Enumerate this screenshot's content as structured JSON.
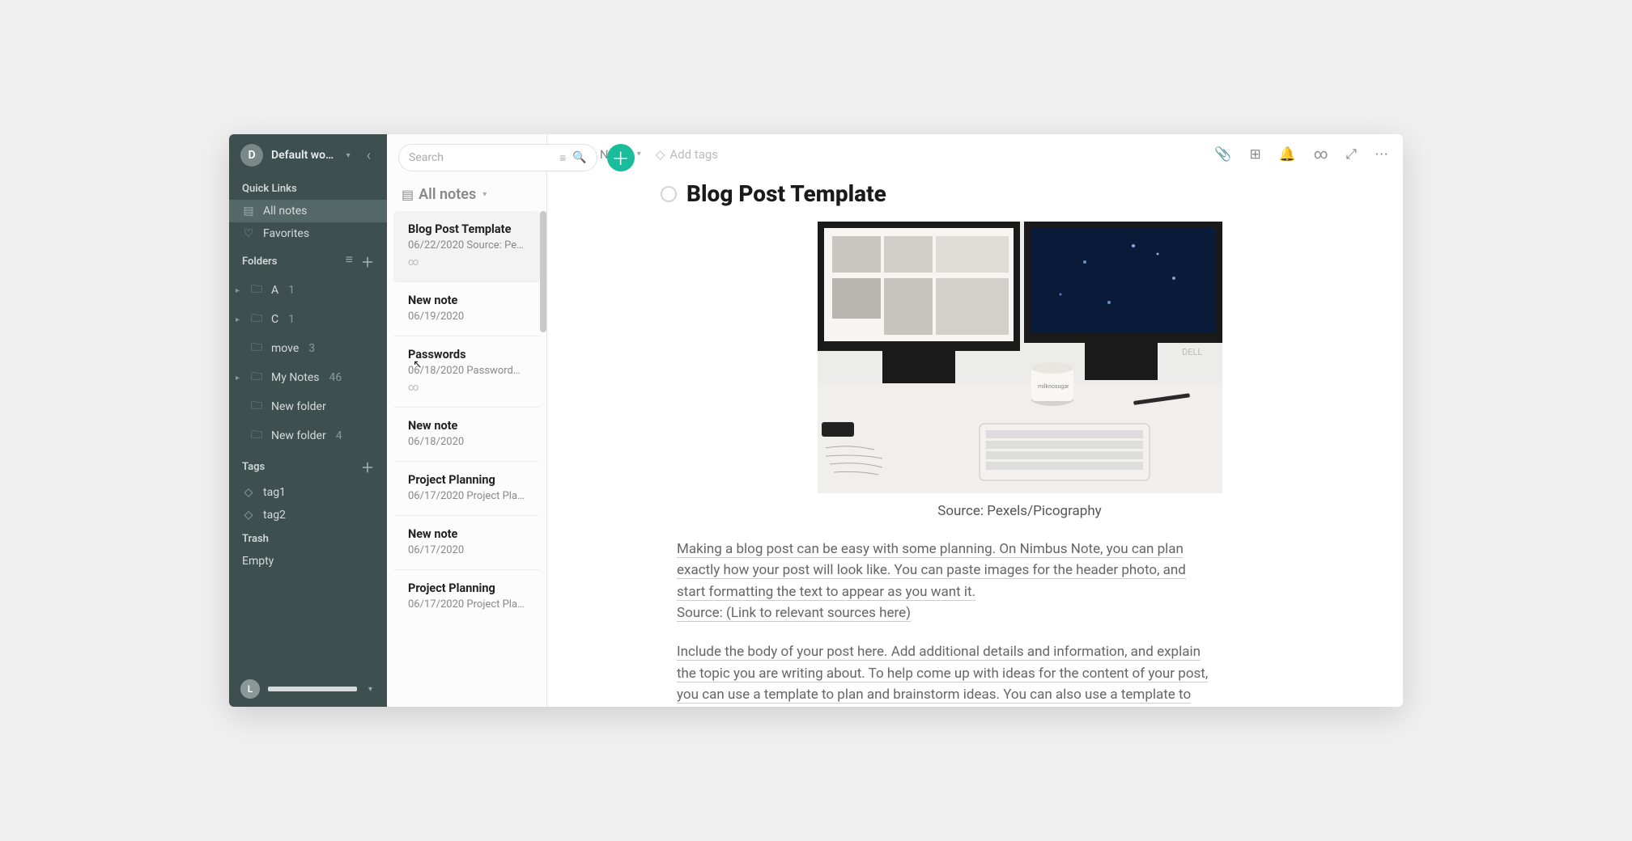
{
  "workspace": {
    "avatar_letter": "D",
    "name": "Default wor…"
  },
  "sidebar": {
    "quicklinks_label": "Quick Links",
    "quicklinks": [
      {
        "icon": "▤",
        "label": "All notes",
        "active": true
      },
      {
        "icon": "♡",
        "label": "Favorites"
      }
    ],
    "folders_label": "Folders",
    "folders": [
      {
        "label": "A",
        "count": "1",
        "expandable": true,
        "icon": "folder-share"
      },
      {
        "label": "C",
        "count": "1",
        "expandable": true,
        "icon": "folder"
      },
      {
        "label": "move",
        "count": "3",
        "expandable": false,
        "icon": "folder"
      },
      {
        "label": "My Notes",
        "count": "46",
        "expandable": true,
        "icon": "folder"
      },
      {
        "label": "New folder",
        "count": "",
        "expandable": false,
        "icon": "folder"
      },
      {
        "label": "New folder",
        "count": "4",
        "expandable": false,
        "icon": "folder-share"
      }
    ],
    "tags_label": "Tags",
    "tags": [
      {
        "label": "tag1"
      },
      {
        "label": "tag2"
      }
    ],
    "trash_label": "Trash",
    "trash_empty": "Empty",
    "user_letter": "L"
  },
  "search": {
    "placeholder": "Search"
  },
  "notelist": {
    "heading": "All notes",
    "items": [
      {
        "title": "Blog Post Template",
        "date": "06/22/2020",
        "excerpt": "Source: Pexe…",
        "shared": true,
        "selected": true
      },
      {
        "title": "New note",
        "date": "06/19/2020",
        "excerpt": "",
        "shared": false,
        "cursor": true
      },
      {
        "title": "Passwords",
        "date": "06/18/2020",
        "excerpt": "Passwords …",
        "shared": true
      },
      {
        "title": "New note",
        "date": "06/18/2020",
        "excerpt": "",
        "shared": false
      },
      {
        "title": "Project Planning",
        "date": "06/17/2020",
        "excerpt": "Project Plan…",
        "shared": false
      },
      {
        "title": "New note",
        "date": "06/17/2020",
        "excerpt": "",
        "shared": false
      },
      {
        "title": "Project Planning",
        "date": "06/17/2020",
        "excerpt": "Project Plan…",
        "shared": false
      }
    ]
  },
  "topbar": {
    "breadcrumb": "My Notes",
    "add_tags": "Add tags"
  },
  "document": {
    "title": "Blog Post Template",
    "caption": "Source: Pexels/Picography",
    "p1": "Making a blog post can be easy with some planning. On Nimbus Note, you can plan exactly how your post will look like. You can paste images for the header photo, and start formatting the text to appear as you want it.",
    "p2": "Source: (Link to relevant sources here)",
    "p3": "Include the body of your post here. Add additional details and information, and explain the topic you are writing about. To help come up with ideas for the content of your post, you can use a template to plan and brainstorm ideas. You can also use a template to lay out relevant keywords, deadlines, and revisions."
  }
}
